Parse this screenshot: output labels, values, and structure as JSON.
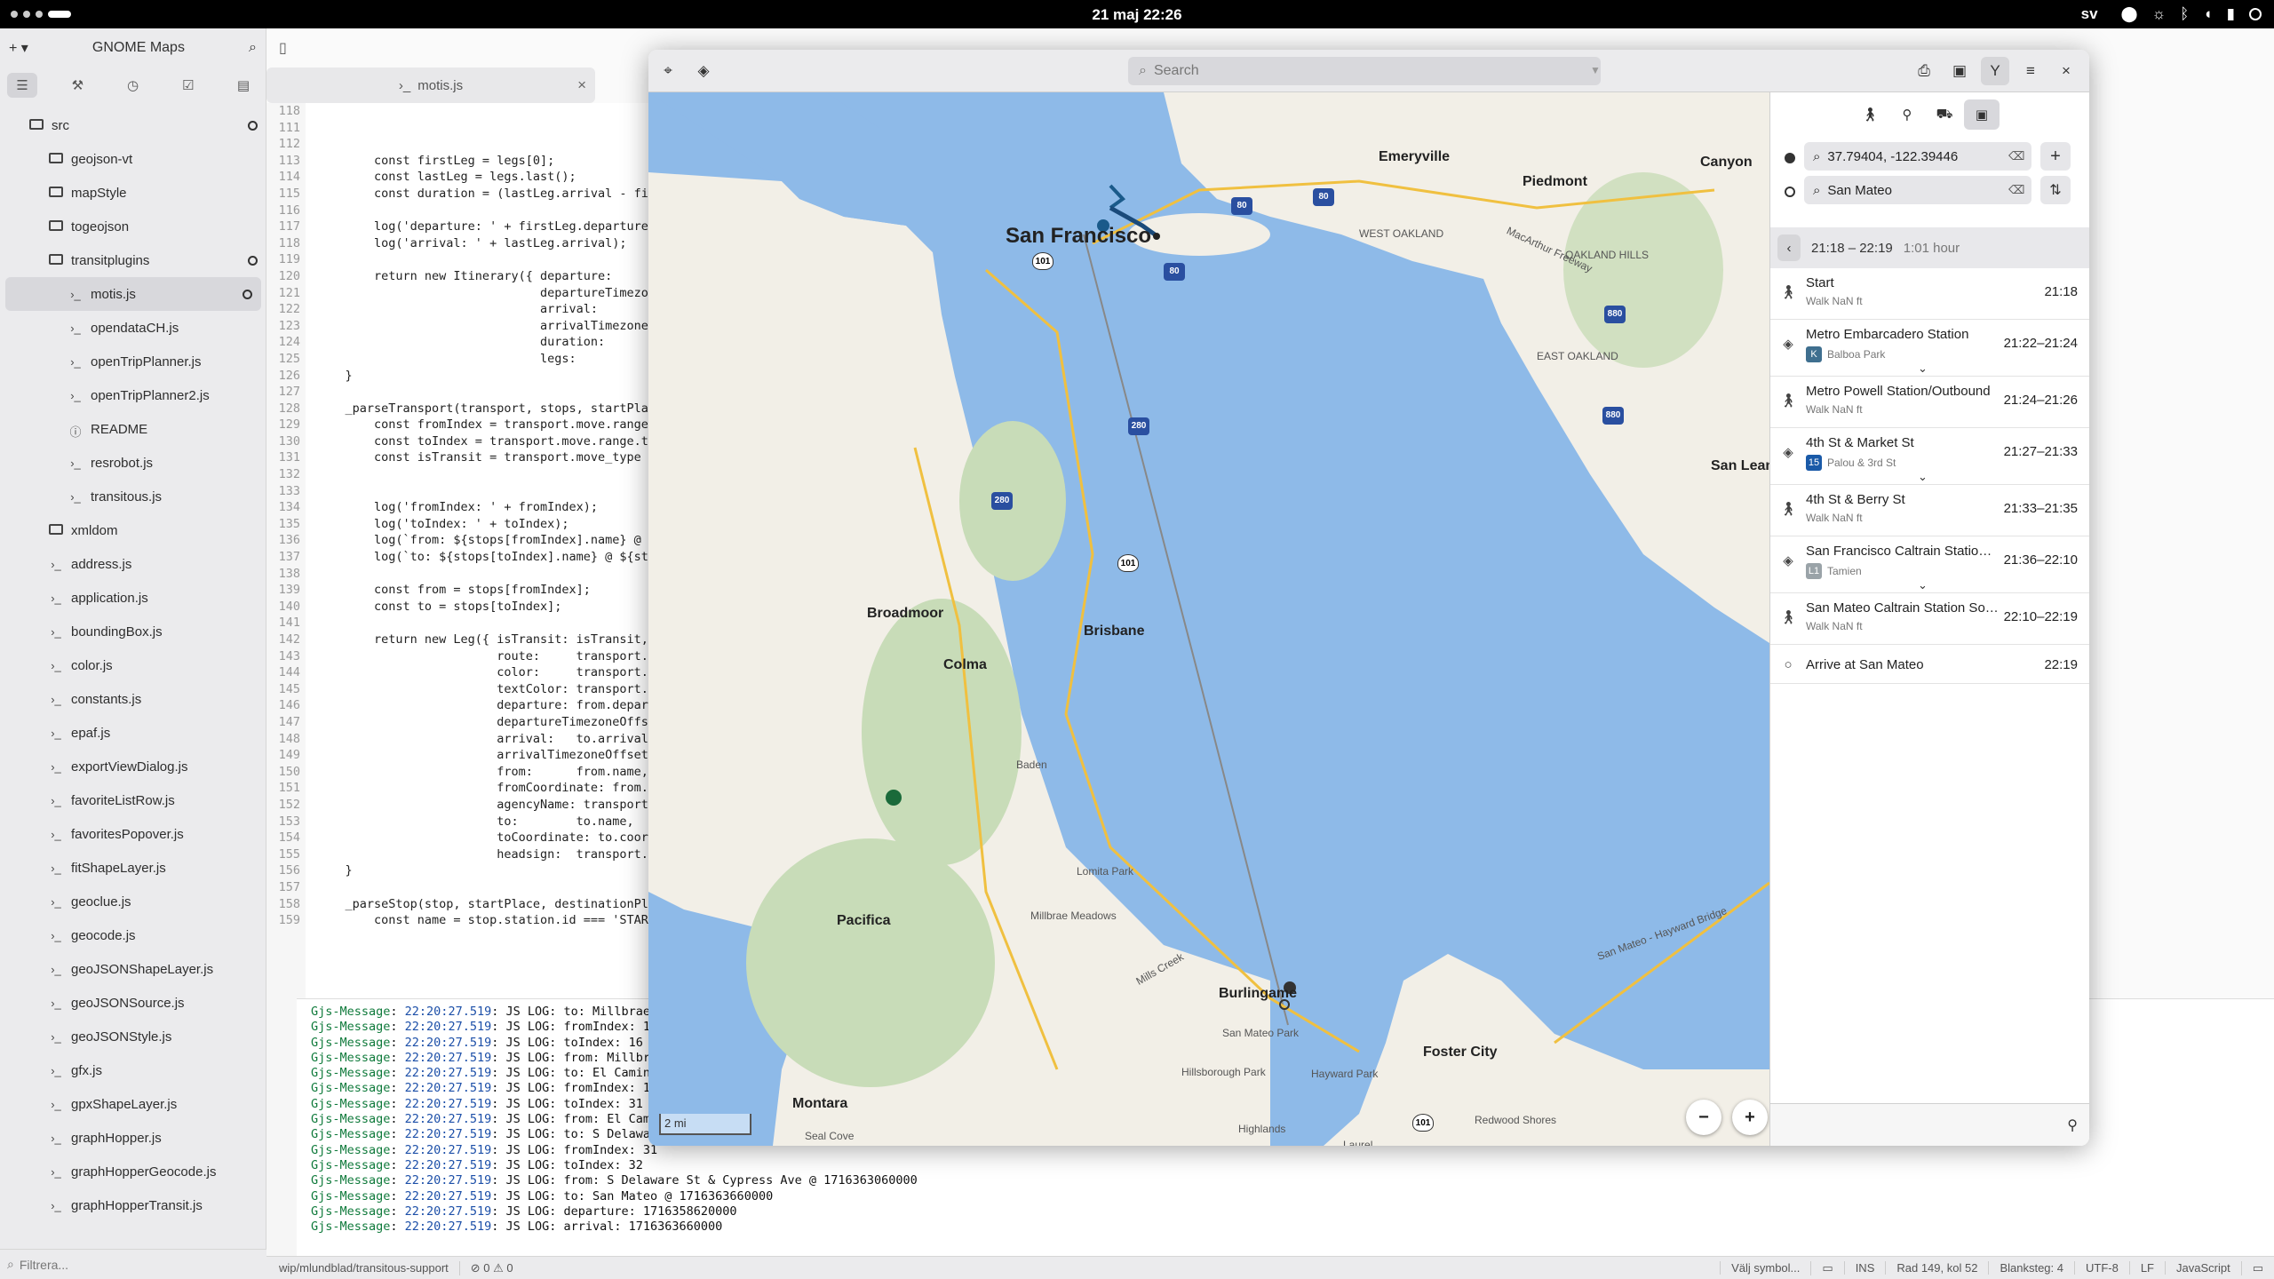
{
  "topbar": {
    "clock": "21 maj  22:26",
    "lang": "sv"
  },
  "builder": {
    "sidebar_title": "GNOME Maps",
    "tab_label": "motis.js",
    "filter_placeholder": "Filtrera...",
    "tree": [
      {
        "label": "src",
        "indent": 1,
        "type": "folder",
        "dot": true
      },
      {
        "label": "geojson-vt",
        "indent": 2,
        "type": "folder"
      },
      {
        "label": "mapStyle",
        "indent": 2,
        "type": "folder"
      },
      {
        "label": "togeojson",
        "indent": 2,
        "type": "folder"
      },
      {
        "label": "transitplugins",
        "indent": 2,
        "type": "folder",
        "dot": true
      },
      {
        "label": "motis.js",
        "indent": 3,
        "type": "file",
        "dot": true,
        "selected": true
      },
      {
        "label": "opendataCH.js",
        "indent": 3,
        "type": "file"
      },
      {
        "label": "openTripPlanner.js",
        "indent": 3,
        "type": "file"
      },
      {
        "label": "openTripPlanner2.js",
        "indent": 3,
        "type": "file"
      },
      {
        "label": "README",
        "indent": 3,
        "type": "info"
      },
      {
        "label": "resrobot.js",
        "indent": 3,
        "type": "file"
      },
      {
        "label": "transitous.js",
        "indent": 3,
        "type": "file"
      },
      {
        "label": "xmldom",
        "indent": 2,
        "type": "folder"
      },
      {
        "label": "address.js",
        "indent": 2,
        "type": "file"
      },
      {
        "label": "application.js",
        "indent": 2,
        "type": "file"
      },
      {
        "label": "boundingBox.js",
        "indent": 2,
        "type": "file"
      },
      {
        "label": "color.js",
        "indent": 2,
        "type": "file"
      },
      {
        "label": "constants.js",
        "indent": 2,
        "type": "file"
      },
      {
        "label": "epaf.js",
        "indent": 2,
        "type": "file"
      },
      {
        "label": "exportViewDialog.js",
        "indent": 2,
        "type": "file"
      },
      {
        "label": "favoriteListRow.js",
        "indent": 2,
        "type": "file"
      },
      {
        "label": "favoritesPopover.js",
        "indent": 2,
        "type": "file"
      },
      {
        "label": "fitShapeLayer.js",
        "indent": 2,
        "type": "file"
      },
      {
        "label": "geoclue.js",
        "indent": 2,
        "type": "file"
      },
      {
        "label": "geocode.js",
        "indent": 2,
        "type": "file"
      },
      {
        "label": "geoJSONShapeLayer.js",
        "indent": 2,
        "type": "file"
      },
      {
        "label": "geoJSONSource.js",
        "indent": 2,
        "type": "file"
      },
      {
        "label": "geoJSONStyle.js",
        "indent": 2,
        "type": "file"
      },
      {
        "label": "gfx.js",
        "indent": 2,
        "type": "file"
      },
      {
        "label": "gpxShapeLayer.js",
        "indent": 2,
        "type": "file"
      },
      {
        "label": "graphHopper.js",
        "indent": 2,
        "type": "file"
      },
      {
        "label": "graphHopperGeocode.js",
        "indent": 2,
        "type": "file"
      },
      {
        "label": "graphHopperTransit.js",
        "indent": 2,
        "type": "file"
      }
    ],
    "code": [
      {
        "n": "118",
        "t": ""
      },
      {
        "n": "111",
        "t": ""
      },
      {
        "n": "112",
        "t": ""
      },
      {
        "n": "113",
        "t": "        const firstLeg = legs[0];"
      },
      {
        "n": "114",
        "t": "        const lastLeg = legs.last();"
      },
      {
        "n": "115",
        "t": "        const duration = (lastLeg.arrival - fi"
      },
      {
        "n": "116",
        "t": ""
      },
      {
        "n": "117",
        "t": "        log('departure: ' + firstLeg.departure"
      },
      {
        "n": "118",
        "t": "        log('arrival: ' + lastLeg.arrival);"
      },
      {
        "n": "119",
        "t": ""
      },
      {
        "n": "120",
        "t": "        return new Itinerary({ departure:"
      },
      {
        "n": "121",
        "t": "                               departureTimezo"
      },
      {
        "n": "122",
        "t": "                               arrival:"
      },
      {
        "n": "123",
        "t": "                               arrivalTimezone"
      },
      {
        "n": "124",
        "t": "                               duration:"
      },
      {
        "n": "125",
        "t": "                               legs:"
      },
      {
        "n": "126",
        "t": "    }"
      },
      {
        "n": "127",
        "t": ""
      },
      {
        "n": "128",
        "t": "    _parseTransport(transport, stops, startPla"
      },
      {
        "n": "129",
        "t": "        const fromIndex = transport.move.range"
      },
      {
        "n": "130",
        "t": "        const toIndex = transport.move.range.to"
      },
      {
        "n": "131",
        "t": "        const isTransit = transport.move_type ="
      },
      {
        "n": "132",
        "t": ""
      },
      {
        "n": "133",
        "t": ""
      },
      {
        "n": "134",
        "t": "        log('fromIndex: ' + fromIndex);"
      },
      {
        "n": "135",
        "t": "        log('toIndex: ' + toIndex);"
      },
      {
        "n": "136",
        "t": "        log(`from: ${stops[fromIndex].name} @ "
      },
      {
        "n": "137",
        "t": "        log(`to: ${stops[toIndex].name} @ ${sto"
      },
      {
        "n": "138",
        "t": ""
      },
      {
        "n": "139",
        "t": "        const from = stops[fromIndex];"
      },
      {
        "n": "140",
        "t": "        const to = stops[toIndex];"
      },
      {
        "n": "141",
        "t": ""
      },
      {
        "n": "142",
        "t": "        return new Leg({ isTransit: isTransit,"
      },
      {
        "n": "143",
        "t": "                         route:     transport."
      },
      {
        "n": "144",
        "t": "                         color:     transport."
      },
      {
        "n": "145",
        "t": "                         textColor: transport."
      },
      {
        "n": "146",
        "t": "                         departure: from.depart"
      },
      {
        "n": "147",
        "t": "                         departureTimezoneOffs"
      },
      {
        "n": "148",
        "t": "                         arrival:   to.arrival"
      },
      {
        "n": "149",
        "t": "                         arrivalTimezoneOffset"
      },
      {
        "n": "150",
        "t": "                         from:      from.name,"
      },
      {
        "n": "151",
        "t": "                         fromCoordinate: from."
      },
      {
        "n": "152",
        "t": "                         agencyName: transport."
      },
      {
        "n": "153",
        "t": "                         to:        to.name,"
      },
      {
        "n": "154",
        "t": "                         toCoordinate: to.coor"
      },
      {
        "n": "155",
        "t": "                         headsign:  transport."
      },
      {
        "n": "156",
        "t": "    }"
      },
      {
        "n": "157",
        "t": ""
      },
      {
        "n": "158",
        "t": "    _parseStop(stop, startPlace, destinationPl"
      },
      {
        "n": "159",
        "t": "        const name = stop.station.id === 'START"
      }
    ],
    "terminal": [
      {
        "ts": "22:20:27.519",
        "msg": ": JS LOG: to: Millbrae"
      },
      {
        "ts": "22:20:27.519",
        "msg": ": JS LOG: fromIndex: 15"
      },
      {
        "ts": "22:20:27.519",
        "msg": ": JS LOG: toIndex: 16"
      },
      {
        "ts": "22:20:27.519",
        "msg": ": JS LOG: from: Millbra"
      },
      {
        "ts": "22:20:27.519",
        "msg": ": JS LOG: to: El Camino"
      },
      {
        "ts": "22:20:27.519",
        "msg": ": JS LOG: fromIndex: 16"
      },
      {
        "ts": "22:20:27.519",
        "msg": ": JS LOG: toIndex: 31"
      },
      {
        "ts": "22:20:27.519",
        "msg": ": JS LOG: from: El Cami"
      },
      {
        "ts": "22:20:27.519",
        "msg": ": JS LOG: to: S Delawar"
      },
      {
        "ts": "22:20:27.519",
        "msg": ": JS LOG: fromIndex: 31"
      },
      {
        "ts": "22:20:27.519",
        "msg": ": JS LOG: toIndex: 32"
      },
      {
        "ts": "22:20:27.519",
        "msg": ": JS LOG: from: S Delaware St & Cypress Ave @ 1716363060000"
      },
      {
        "ts": "22:20:27.519",
        "msg": ": JS LOG: to: San Mateo @ 1716363660000"
      },
      {
        "ts": "22:20:27.519",
        "msg": ": JS LOG: departure: 1716358620000"
      },
      {
        "ts": "22:20:27.519",
        "msg": ": JS LOG: arrival: 1716363660000"
      }
    ],
    "terminal_tag": "Gjs-Message",
    "status": {
      "branch": "wip/mlundblad/transitous-support",
      "errors": "0",
      "warnings": "0",
      "symbol": "Välj symbol...",
      "mode": "INS",
      "position": "Rad 149, kol 52",
      "spaces": "Blanksteg: 4",
      "encoding": "UTF-8",
      "eol": "LF",
      "lang": "JavaScript"
    }
  },
  "maps": {
    "search_placeholder": "Search",
    "from_value": "37.79404, -122.39446",
    "to_value": "San Mateo",
    "itinerary_time": "21:18 – 22:19",
    "itinerary_duration": "1:01 hour",
    "scale": "2 mi",
    "places": {
      "sf": "San Francisco",
      "emeryville": "Emeryville",
      "piedmont": "Piedmont",
      "canyon": "Canyon",
      "broadmoor": "Broadmoor",
      "brisbane": "Brisbane",
      "colma": "Colma",
      "pacifica": "Pacifica",
      "burlingame": "Burlingame",
      "foster": "Foster City",
      "montara": "Montara",
      "sanlean": "San Lean"
    },
    "small_places": {
      "westoak": "WEST OAKLAND",
      "oakhills": "OAKLAND HILLS",
      "eastoak": "EAST OAKLAND",
      "baden": "Baden",
      "lomita": "Lomita Park",
      "millbrae": "Millbrae Meadows",
      "smpark": "San Mateo Park",
      "hillsb": "Hillsborough Park",
      "hayward": "Hayward Park",
      "laurel": "Laurel",
      "redwood": "Redwood Shores",
      "highlands": "Highlands",
      "seal": "Seal Cove",
      "bridge": "San Mateo - Hayward Bridge",
      "millscreek": "Mills Creek",
      "macarthur": "MacArthur Freeway"
    },
    "steps": [
      {
        "icon": "walk",
        "title": "Start",
        "sub": "Walk NaN ft",
        "time": "21:18"
      },
      {
        "icon": "transit",
        "title": "Metro Embarcadero Station",
        "badge": "K",
        "badge_color": "#3f6f8f",
        "sub": "Balboa Park",
        "time": "21:22–21:24",
        "expand": true
      },
      {
        "icon": "walk",
        "title": "Metro Powell Station/Outbound",
        "sub": "Walk NaN ft",
        "time": "21:24–21:26"
      },
      {
        "icon": "transit",
        "title": "4th St & Market St",
        "badge": "15",
        "badge_color": "#1a5aa8",
        "sub": "Palou & 3rd St",
        "time": "21:27–21:33",
        "expand": true
      },
      {
        "icon": "walk",
        "title": "4th St & Berry St",
        "sub": "Walk NaN ft",
        "time": "21:33–21:35"
      },
      {
        "icon": "transit",
        "title": "San Francisco Caltrain Statio…",
        "badge": "L1",
        "badge_color": "#9aa3a8",
        "sub": "Tamien",
        "time": "21:36–22:10",
        "expand": true
      },
      {
        "icon": "walk",
        "title": "San Mateo Caltrain Station So…",
        "sub": "Walk NaN ft",
        "time": "22:10–22:19"
      },
      {
        "icon": "end",
        "title": "Arrive at San Mateo",
        "sub": "",
        "time": "22:19"
      }
    ],
    "shields": {
      "i80a": "80",
      "i80b": "80",
      "i80c": "80",
      "i80d": "880",
      "i80e": "880",
      "i280a": "280",
      "i280b": "280",
      "us101a": "101",
      "us101b": "101",
      "us101c": "101"
    }
  }
}
